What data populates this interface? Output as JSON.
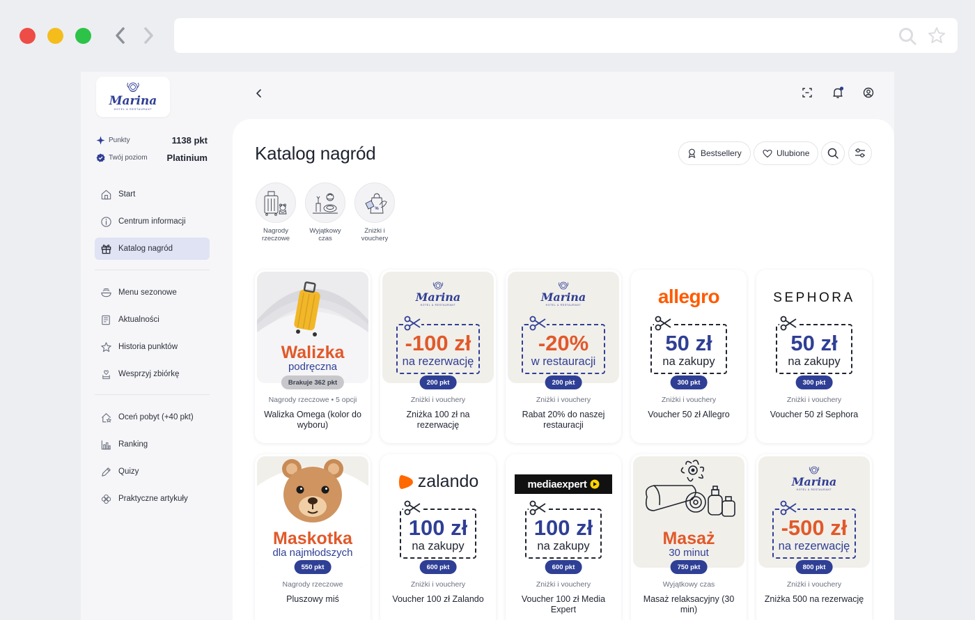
{
  "browser": {
    "url": ""
  },
  "sidebar": {
    "logo_text": "Marina",
    "logo_sub": "HOTEL & RESTAURANT",
    "points_label": "Punkty",
    "points_value": "1138 pkt",
    "level_label": "Twój poziom",
    "level_value": "Platinium",
    "items": [
      {
        "label": "Start",
        "icon": "home-icon"
      },
      {
        "label": "Centrum informacji",
        "icon": "info-icon"
      },
      {
        "label": "Katalog nagród",
        "icon": "gift-icon",
        "active": true
      },
      {
        "label": "Menu sezonowe",
        "icon": "bowl-icon"
      },
      {
        "label": "Aktualności",
        "icon": "news-icon"
      },
      {
        "label": "Historia punktów",
        "icon": "star-icon"
      },
      {
        "label": "Wesprzyj zbiórkę",
        "icon": "heart-hand-icon"
      },
      {
        "label": "Oceń pobyt (+40 pkt)",
        "icon": "rate-icon"
      },
      {
        "label": "Ranking",
        "icon": "ranking-icon"
      },
      {
        "label": "Quizy",
        "icon": "pencil-icon"
      },
      {
        "label": "Praktyczne artykuły",
        "icon": "flower-icon"
      }
    ]
  },
  "header": {
    "title": "Katalog nagród",
    "bestsellers_label": "Bestsellery",
    "favorites_label": "Ulubione"
  },
  "categories": [
    {
      "label": "Nagrody\nrzeczowe",
      "icon": "luggage-icon"
    },
    {
      "label": "Wyjątkowy\nczas",
      "icon": "spa-icon"
    },
    {
      "label": "Zniżki i\nvouchery",
      "icon": "voucher-icon"
    }
  ],
  "products": [
    {
      "title": "Walizka",
      "subtitle": "podręczna",
      "points": "Brakuje 362 pkt",
      "category": "Nagrody rzeczowe • 5 opcji",
      "name": "Walizka Omega (kolor do wyboru)"
    },
    {
      "brand": "Marina",
      "value": "-100 zł",
      "value_sub": "na rezerwację",
      "points": "200 pkt",
      "category": "Zniżki i vouchery",
      "name": "Zniżka 100 zł na rezerwację"
    },
    {
      "brand": "Marina",
      "value": "-20%",
      "value_sub": "w restauracji",
      "points": "200 pkt",
      "category": "Zniżki i vouchery",
      "name": "Rabat 20% do naszej restauracji"
    },
    {
      "brand": "allegro",
      "value": "50 zł",
      "value_sub": "na zakupy",
      "points": "300 pkt",
      "category": "Zniżki i vouchery",
      "name": "Voucher 50 zł Allegro"
    },
    {
      "brand": "SEPHORA",
      "value": "50 zł",
      "value_sub": "na zakupy",
      "points": "300 pkt",
      "category": "Zniżki i vouchery",
      "name": "Voucher 50 zł Sephora"
    },
    {
      "title": "Maskotka",
      "subtitle": "dla najmłodszych",
      "points": "550 pkt",
      "category": "Nagrody rzeczowe",
      "name": "Pluszowy miś"
    },
    {
      "brand": "zalando",
      "value": "100 zł",
      "value_sub": "na zakupy",
      "points": "600 pkt",
      "category": "Zniżki i vouchery",
      "name": "Voucher 100 zł Zalando"
    },
    {
      "brand": "mediaexpert",
      "value": "100 zł",
      "value_sub": "na zakupy",
      "points": "600 pkt",
      "category": "Zniżki i vouchery",
      "name": "Voucher 100 zł Media Expert"
    },
    {
      "title": "Masaż",
      "subtitle": "30 minut",
      "points": "750 pkt",
      "category": "Wyjątkowy czas",
      "name": "Masaż relaksacyjny (30 min)"
    },
    {
      "brand": "Marina",
      "value": "-500 zł",
      "value_sub": "na rezerwację",
      "points": "800 pkt",
      "category": "Zniżki i vouchery",
      "name": "Zniżka 500 na rezerwację"
    }
  ],
  "colors": {
    "accent_navy": "#2f3f95",
    "accent_orange": "#e1592a",
    "active_nav_bg": "#dfe3f3"
  }
}
